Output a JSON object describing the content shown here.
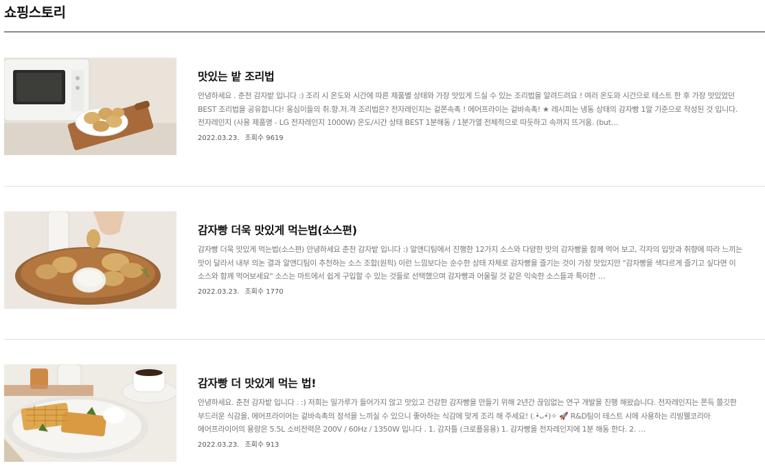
{
  "page": {
    "title": "쇼핑스토리"
  },
  "posts": [
    {
      "title": "맛있는 밭 조리법",
      "excerpt": "안녕하세요 . 춘천 감자밭 입니다 :) 조리 시 온도와 시간에 따른 제품별 상태와 가장 맛있게 드실 수 있는 조리법을 알려드려요 ! 여러 온도와 시간으로 테스트 한 후 가장 맛있었던 BEST 조리법을 공유합니다! 옹심이들의 취.향.저.격 조리법은? 전자레인지는 겉쫀속촉 ! 에어프라이는 겉바속촉! ★ 레시피는 냉동 상태의 감자빵 1알 기준으로 작성된 것 입니다. 전자레인지 (사용 제품명 - LG 전자레인지 1000W) 온도/시간 상태 BEST 1분해동 / 1분가열 전체적으로 따듯하고 속까지 뜨거움. (but…",
      "date": "2022.03.23.",
      "views": "조회수 9619",
      "image": "microwave-potato-bread-photo"
    },
    {
      "title": "감자빵 더욱 맛있게 먹는법(소스편)",
      "excerpt": "감자빵 더욱 맛있게 먹는법(소스편) 안녕하세요 춘천 감자밭 입니다 :) 알앤디팀에서 진행한 12가지 소스와 다양한 맛의 감자빵을 함께 먹어 보고, 각자의 입맛과 취향에 따라 느끼는 맛이 달라서 내부 의논 결과 알앤디팀이 추천하는 소스 조합(원픽) 이런 느낌보다는 순수한 상태 자체로 감자빵을 즐기는 것이 가장 맛있지만 \"감자빵을 색다르게 즐기고 싶다면 이 소스와 함께 먹어보세요\" 소스는 마트에서 쉽게 구입할 수 있는 것들로 선택했으며 감자빵과 어울릴 것 같은 익숙한 소스들과 특이한 …",
      "date": "2022.03.23.",
      "views": "조회수 1770",
      "image": "potato-bread-with-sauce-photo"
    },
    {
      "title": "감자빵 더 맛있게 먹는 법!",
      "excerpt": "안녕하세요. 춘천 감자밭 입니다 . :) 저희는 밀가루가 들어가지 않고 맛있고 건강한 감자빵을 만들기 위해 2년간 끊임없는 연구 개발을 진행 해왔습니다. 전자레인지는 쫀득 쫄깃한 부드러운 식감을, 에어프라이어는 겉바속촉의 정석을 느끼실 수 있으니 좋아하는 식감에 맞게 조리 해 주세요! (.•̀ᴗ•́)✧ 🚀 R&D팀이 테스트 시에 사용하는 리빙웰코리아 에어프라이어의 용량은 5.5L 소비전력은 200V / 60Hz / 1350W 입니다 . 1. 감자틀 (크로플응용) 1. 감자빵을 전자레인지에 1분 해동 한다. 2. …",
      "date": "2022.03.23.",
      "views": "조회수 913",
      "image": "potato-waffle-plate-photo"
    }
  ]
}
